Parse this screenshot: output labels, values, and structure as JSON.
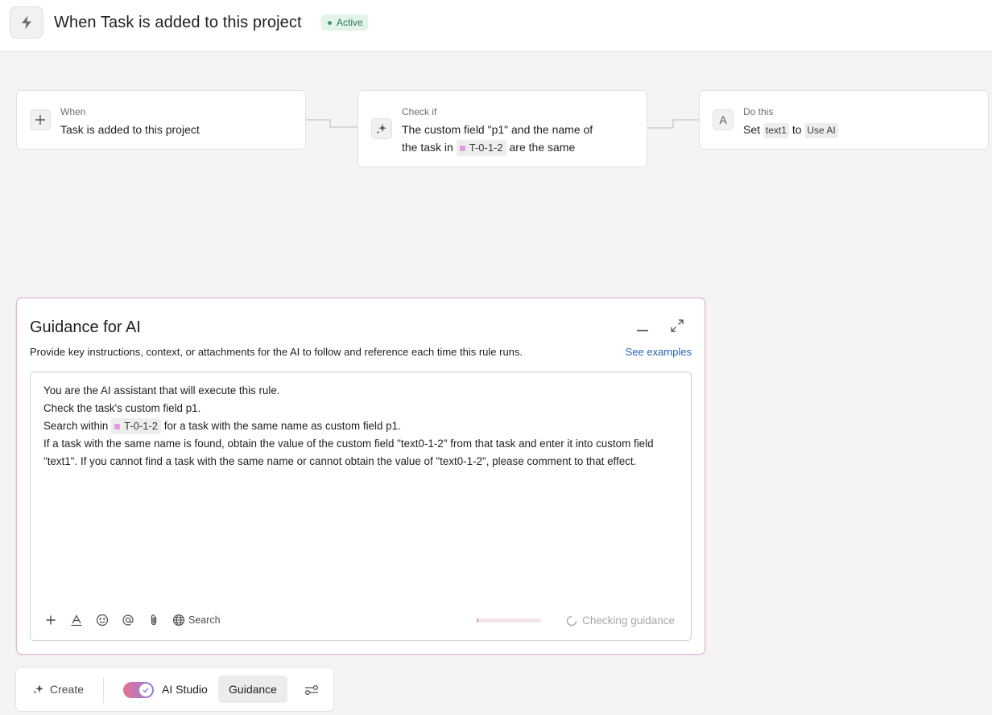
{
  "header": {
    "title": "When Task is added to this project",
    "status": "Active",
    "icon": "lightning-bolt-icon"
  },
  "rule": {
    "trigger": {
      "label": "When",
      "text": "Task is added to this project",
      "icon": "plus-icon"
    },
    "condition": {
      "label": "Check if",
      "line1": "The custom field \"p1\" and the name of",
      "line2_prefix": "the task in",
      "project_chip": "T-0-1-2",
      "line2_suffix": "are the same",
      "icon": "sparkle-icon"
    },
    "action": {
      "label": "Do this",
      "prefix": "Set",
      "field_chip": "text1",
      "mid": "to",
      "value_chip": "Use AI",
      "icon": "text-field-icon"
    }
  },
  "guidance": {
    "title": "Guidance for AI",
    "description": "Provide key instructions, context, or attachments for the AI to follow and reference each time this rule runs.",
    "see_examples": "See examples",
    "body": {
      "line1": "You are the AI assistant that will execute this rule.",
      "line2": "Check the task's custom field p1.",
      "line3_prefix": "Search within",
      "line3_chip": "T-0-1-2",
      "line3_suffix": "for a task with the same name as custom field p1.",
      "line4": "If a task with the same name is found, obtain the value of the custom field \"text0-1-2\" from that task and enter it into custom field \"text1\". If you cannot find a task with the same name or cannot obtain the value of \"text0-1-2\", please comment to that effect."
    },
    "toolbar": {
      "search_label": "Search"
    },
    "checking_label": "Checking guidance",
    "progress": 0.03
  },
  "bottom_bar": {
    "create_label": "Create",
    "ai_studio_label": "AI Studio",
    "guidance_tab_label": "Guidance",
    "ai_studio_enabled": true
  },
  "colors": {
    "active_green": "#2b7a50",
    "link_blue": "#2862b8",
    "chip_pink": "#e49be0",
    "toggle_start": "#e8738f",
    "toggle_end": "#8f7de6"
  }
}
